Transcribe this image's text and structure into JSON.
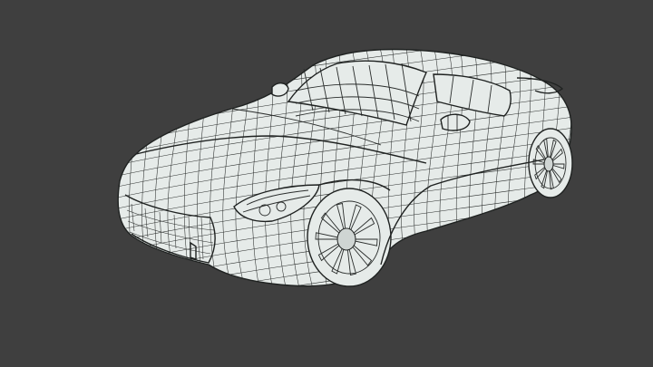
{
  "scene": {
    "subject": "",
    "colors": {
      "background": "#3f3f3f",
      "mesh_surface": "#e6ebe9",
      "wire": "#2a2d2c"
    }
  }
}
